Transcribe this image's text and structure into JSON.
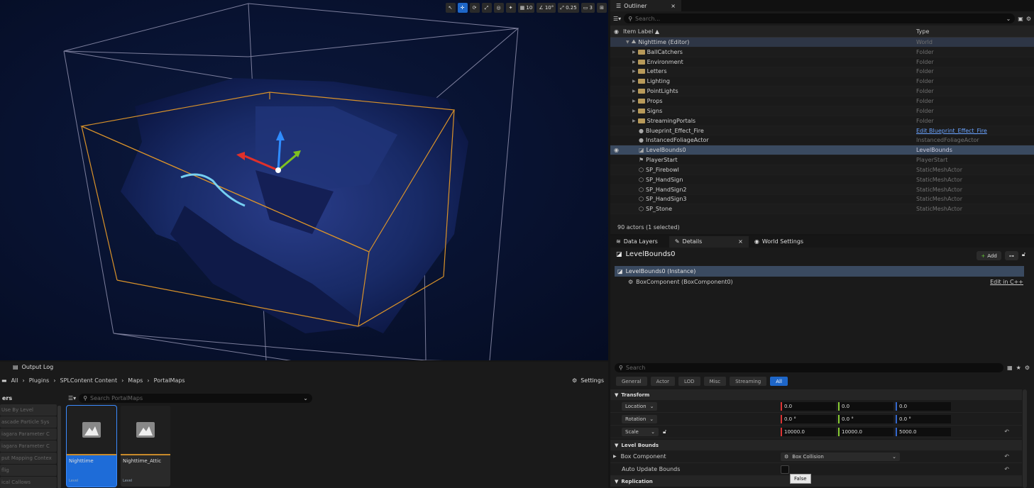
{
  "viewport": {
    "toolbar": {
      "grid": "10",
      "angle": "10°",
      "scale": "0.25",
      "camera": "3"
    }
  },
  "outliner": {
    "tab_label": "Outliner",
    "search_placeholder": "Search...",
    "col_label": "Item Label ▲",
    "col_type": "Type",
    "rows": [
      {
        "label": "Nighttime (Editor)",
        "type": "World"
      },
      {
        "label": "BallCatchers",
        "type": "Folder"
      },
      {
        "label": "Environment",
        "type": "Folder"
      },
      {
        "label": "Letters",
        "type": "Folder"
      },
      {
        "label": "Lighting",
        "type": "Folder"
      },
      {
        "label": "PointLights",
        "type": "Folder"
      },
      {
        "label": "Props",
        "type": "Folder"
      },
      {
        "label": "Signs",
        "type": "Folder"
      },
      {
        "label": "StreamingPortals",
        "type": "Folder"
      },
      {
        "label": "Blueprint_Effect_Fire",
        "type": "Edit Blueprint_Effect_Fire"
      },
      {
        "label": "InstancedFoliageActor",
        "type": "InstancedFoliageActor"
      },
      {
        "label": "LevelBounds0",
        "type": "LevelBounds"
      },
      {
        "label": "PlayerStart",
        "type": "PlayerStart"
      },
      {
        "label": "SP_Firebowl",
        "type": "StaticMeshActor"
      },
      {
        "label": "SP_HandSign",
        "type": "StaticMeshActor"
      },
      {
        "label": "SP_HandSign2",
        "type": "StaticMeshActor"
      },
      {
        "label": "SP_HandSign3",
        "type": "StaticMeshActor"
      },
      {
        "label": "SP_Stone",
        "type": "StaticMeshActor"
      }
    ],
    "status": "90 actors (1 selected)"
  },
  "details": {
    "tabs": [
      "Data Layers",
      "Details",
      "World Settings"
    ],
    "title": "LevelBounds0",
    "add_label": "Add",
    "instance_label": "LevelBounds0 (Instance)",
    "component_label": "BoxComponent (BoxComponent0)",
    "edit_cpp": "Edit in C++",
    "search_placeholder": "Search",
    "filters": [
      "General",
      "Actor",
      "LOD",
      "Misc",
      "Streaming",
      "All"
    ],
    "transform_section": "Transform",
    "location_label": "Location",
    "location": [
      "0.0",
      "0.0",
      "0.0"
    ],
    "rotation_label": "Rotation",
    "rotation": [
      "0.0 °",
      "0.0 °",
      "0.0 °"
    ],
    "scale_label": "Scale",
    "scale": [
      "10000.0",
      "10000.0",
      "5000.0"
    ],
    "levelbounds_section": "Level Bounds",
    "box_component_label": "Box Component",
    "box_component_value": "Box Collision",
    "auto_update_label": "Auto Update Bounds",
    "tooltip": "False",
    "replication_section": "Replication"
  },
  "browser": {
    "output_log": "Output Log",
    "breadcrumb": [
      "All",
      "Plugins",
      "SPLContent Content",
      "Maps",
      "PortalMaps"
    ],
    "settings": "Settings",
    "filters_title": "ers",
    "search_placeholder": "Search PortalMaps",
    "side_items": [
      "Use By Level",
      "ascade Particle Sys",
      "iagara Parameter C",
      "iagara Parameter C",
      "put Mapping Contex",
      "flig",
      "ical Callows"
    ],
    "assets": [
      {
        "name": "Nighttime",
        "type": "Level"
      },
      {
        "name": "Nighttime_Attic",
        "type": "Level"
      }
    ]
  }
}
